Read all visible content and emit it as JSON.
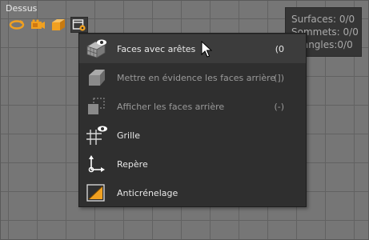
{
  "view": {
    "label": "Dessus"
  },
  "toolbar": {
    "icons": [
      "orbit-icon",
      "camera-icon",
      "cube-icon",
      "view-options-icon"
    ]
  },
  "stats": {
    "surfaces": "Surfaces: 0/0",
    "sommets": "Sommets: 0/0",
    "triangles": "Triangles:0/0"
  },
  "menu": {
    "items": [
      {
        "label": "Faces avec arêtes",
        "shortcut": "(0",
        "enabled": true
      },
      {
        "label": "Mettre en évidence les faces arrière",
        "shortcut": "(])",
        "enabled": false
      },
      {
        "label": "Afficher les faces arrière",
        "shortcut": "(-)",
        "enabled": false
      },
      {
        "label": "Grille",
        "shortcut": "",
        "enabled": true
      },
      {
        "label": "Repère",
        "shortcut": "",
        "enabled": true
      },
      {
        "label": "Anticrénelage",
        "shortcut": "",
        "enabled": true
      }
    ]
  },
  "colors": {
    "accent": "#f0a020",
    "menu_bg": "#2f2f2f",
    "hover_bg": "#3c3c3c"
  }
}
